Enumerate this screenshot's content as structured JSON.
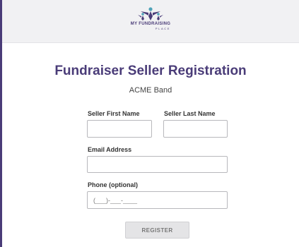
{
  "brand": {
    "logo_main": "MY FUNDRAISING",
    "logo_sub": "PLACE",
    "primary_color": "#4a3c78",
    "accent_color": "#4fa3b8"
  },
  "page": {
    "title": "Fundraiser Seller Registration",
    "subtitle": "ACME Band"
  },
  "form": {
    "first_name": {
      "label": "Seller First Name",
      "value": "",
      "placeholder": ""
    },
    "last_name": {
      "label": "Seller Last Name",
      "value": "",
      "placeholder": ""
    },
    "email": {
      "label": "Email Address",
      "value": "",
      "placeholder": ""
    },
    "phone": {
      "label": "Phone (optional)",
      "value": "",
      "placeholder": "(___)-___-____"
    },
    "register_label": "REGISTER"
  }
}
